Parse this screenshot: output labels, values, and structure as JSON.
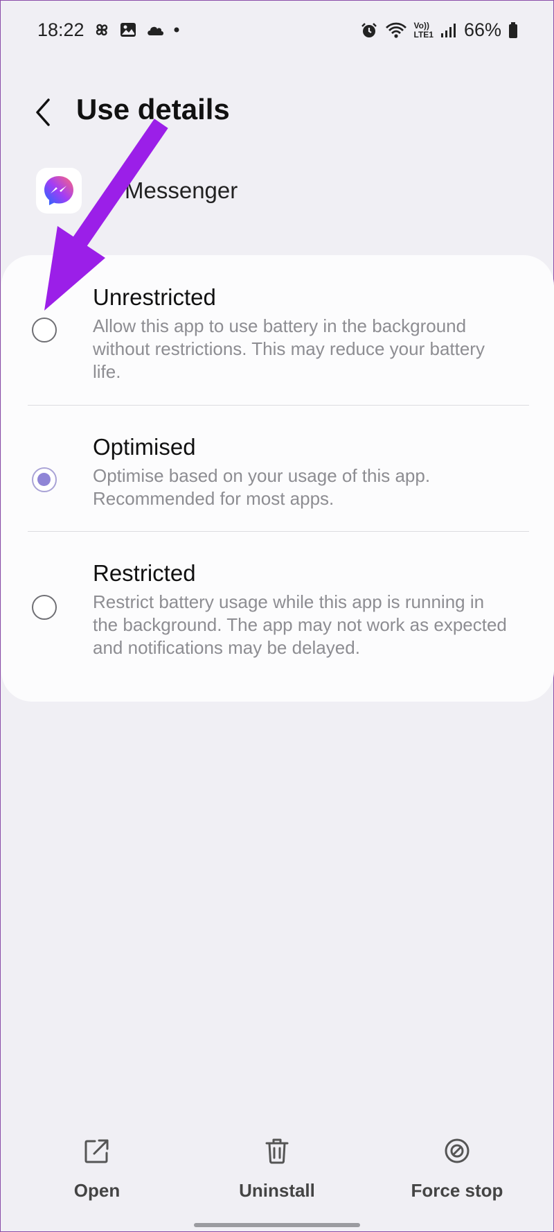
{
  "status_bar": {
    "time": "18:22",
    "left_icons": [
      "pinwheel-icon",
      "gallery-icon",
      "cloud-icon",
      "dot-icon"
    ],
    "right_icons": [
      "alarm-icon",
      "wifi-icon",
      "volte-icon",
      "signal-icon",
      "battery-icon"
    ],
    "volte_top": "Vo))",
    "volte_bottom": "LTE1",
    "battery": "66%"
  },
  "header": {
    "title": "Use details",
    "back_icon": "back-chevron-icon"
  },
  "app": {
    "name": "Messenger",
    "icon": "messenger-icon"
  },
  "battery_options": {
    "selected": "Optimised",
    "items": [
      {
        "title": "Unrestricted",
        "description": "Allow this app to use battery in the background without restrictions. This may reduce your battery life."
      },
      {
        "title": "Optimised",
        "description": "Optimise based on your usage of this app. Recommended for most apps."
      },
      {
        "title": "Restricted",
        "description": "Restrict battery usage while this app is running in the background. The app may not work as expected and notifications may be delayed."
      }
    ]
  },
  "bottom_bar": {
    "open_label": "Open",
    "uninstall_label": "Uninstall",
    "force_stop_label": "Force stop"
  },
  "colors": {
    "background": "#f0eff4",
    "card": "#fcfcfd",
    "radio_selected": "#8f85d6",
    "annotation_arrow": "#9b1fe8"
  }
}
